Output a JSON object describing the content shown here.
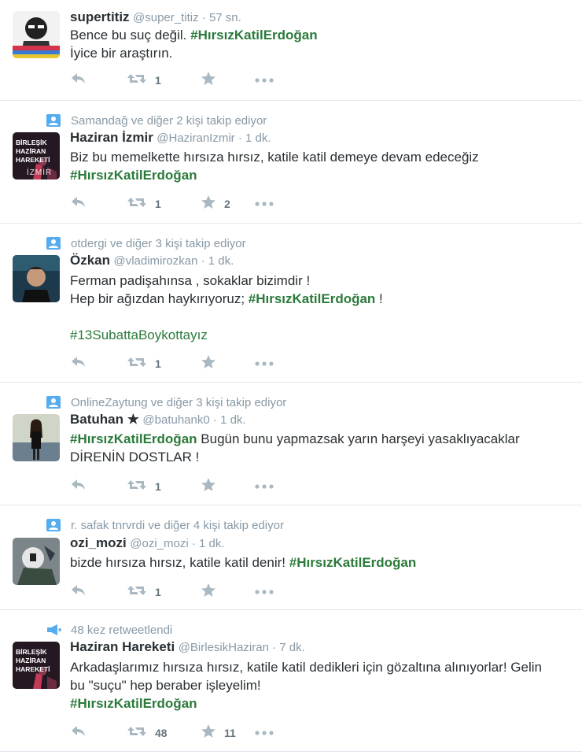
{
  "tweets": [
    {
      "context": "",
      "context_icon": "",
      "name": "supertitiz",
      "handle": "@super_titiz",
      "time": "57 sn.",
      "lines": [
        [
          {
            "t": "Bence bu suç değil. "
          },
          {
            "t": "#HırsızKatilErdoğan",
            "tag": true
          }
        ],
        [
          {
            "t": "İyice bir araştırın."
          }
        ]
      ],
      "retweets": "1",
      "likes": ""
    },
    {
      "context": "Samandağ ve diğer 2 kişi takip ediyor",
      "context_icon": "person-icon",
      "name": "Haziran İzmir",
      "handle": "@HaziranIzmir",
      "time": "1 dk.",
      "avatar_text": [
        "BİRLEŞİK",
        "HAZİRAN",
        "HAREKETİ",
        "İZMİR"
      ],
      "lines": [
        [
          {
            "t": "Biz bu memelkette hırsıza hırsız, katile katil demeye devam edeceğiz"
          }
        ],
        [
          {
            "t": "#HırsızKatilErdoğan",
            "tag": true
          }
        ]
      ],
      "retweets": "1",
      "likes": "2"
    },
    {
      "context": "otdergi ve diğer 3 kişi takip ediyor",
      "context_icon": "person-icon",
      "name": "Özkan",
      "handle": "@vladimirozkan",
      "time": "1 dk.",
      "lines": [
        [
          {
            "t": "Ferman padişahınsa , sokaklar bizimdir !"
          }
        ],
        [
          {
            "t": "Hep bir ağızdan haykırıyoruz; "
          },
          {
            "t": "#HırsızKatilErdoğan",
            "tag": true
          },
          {
            "t": " !"
          }
        ],
        [
          {
            "t": ""
          }
        ],
        [
          {
            "t": "#13SubattaBoykottayız",
            "tag": true,
            "plain": true
          }
        ]
      ],
      "retweets": "1",
      "likes": ""
    },
    {
      "context": "OnlineZaytung ve diğer 3 kişi takip ediyor",
      "context_icon": "person-icon",
      "name": "Batuhan ★",
      "handle": "@batuhank0",
      "time": "1 dk.",
      "lines": [
        [
          {
            "t": "#HırsızKatilErdoğan",
            "tag": true
          },
          {
            "t": " Bugün bunu yapmazsak yarın harşeyi yasaklıyacaklar"
          }
        ],
        [
          {
            "t": "DİRENİN DOSTLAR !"
          }
        ]
      ],
      "retweets": "1",
      "likes": ""
    },
    {
      "context": "r. safak tnrvrdi ve diğer 4 kişi takip ediyor",
      "context_icon": "person-icon",
      "name": "ozi_mozi",
      "handle": "@ozi_mozi",
      "time": "1 dk.",
      "lines": [
        [
          {
            "t": "bizde hırsıza hırsız, katile katil denir! "
          },
          {
            "t": "#HırsızKatilErdoğan",
            "tag": true
          }
        ]
      ],
      "retweets": "1",
      "likes": ""
    },
    {
      "context": "48 kez retweetlendi",
      "context_icon": "megaphone-icon",
      "name": "Haziran Hareketi",
      "handle": "@BirlesikHaziran",
      "time": "7 dk.",
      "avatar_text": [
        "BİRLEŞİK",
        "HAZİRAN",
        "HAREKETİ",
        ""
      ],
      "lines": [
        [
          {
            "t": "Arkadaşlarımız hırsıza hırsız, katile katil dedikleri için gözaltına alınıyorlar! Gelin"
          }
        ],
        [
          {
            "t": "bu \"suçu\" hep beraber işleyelim!"
          }
        ],
        [
          {
            "t": "#HırsızKatilErdoğan",
            "tag": true
          }
        ]
      ],
      "retweets": "48",
      "likes": "11"
    }
  ],
  "sep": " · ",
  "colors": {
    "hashtag": "#2b7a3b",
    "muted": "#8899a6",
    "context_icon": "#55acee"
  }
}
